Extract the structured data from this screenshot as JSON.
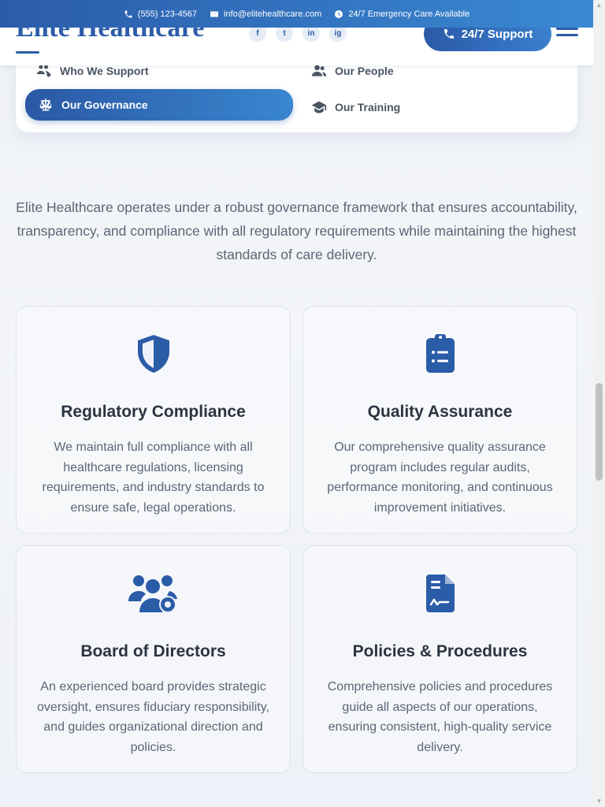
{
  "topbar": {
    "phone": "(555) 123-4567",
    "email": "info@elitehealthcare.com",
    "emergency": "24/7 Emergency Care Available"
  },
  "header": {
    "logo": "Elite Healthcare",
    "support_label": "24/7 Support",
    "socials": [
      "f",
      "t",
      "in",
      "ig"
    ]
  },
  "subnav": {
    "items": [
      {
        "label": "Who We Support",
        "icon": "people-gear-icon"
      },
      {
        "label": "Our People",
        "icon": "users-icon"
      },
      {
        "label": "Our Governance",
        "icon": "scale-icon",
        "active": true
      },
      {
        "label": "Our Training",
        "icon": "graduation-cap-icon"
      }
    ]
  },
  "intro": "Elite Healthcare operates under a robust governance framework that ensures accountability, transparency, and compliance with all regulatory requirements while maintaining the highest standards of care delivery.",
  "cards": [
    {
      "title": "Regulatory Compliance",
      "icon": "shield-icon",
      "text": "We maintain full compliance with all healthcare regulations, licensing requirements, and industry standards to ensure safe, legal operations."
    },
    {
      "title": "Quality Assurance",
      "icon": "clipboard-list-icon",
      "text": "Our comprehensive quality assurance program includes regular audits, performance monitoring, and continuous improvement initiatives."
    },
    {
      "title": "Board of Directors",
      "icon": "users-gear-icon",
      "text": "An experienced board provides strategic oversight, ensures fiduciary responsibility, and guides organizational direction and policies."
    },
    {
      "title": "Policies & Procedures",
      "icon": "file-contract-icon",
      "text": "Comprehensive policies and procedures guide all aspects of our operations, ensuring consistent, high-quality service delivery."
    }
  ],
  "colors": {
    "brand": "#2b5ca8",
    "accent": "#3a86d0",
    "text": "#2b3440",
    "muted": "#5b6675"
  }
}
